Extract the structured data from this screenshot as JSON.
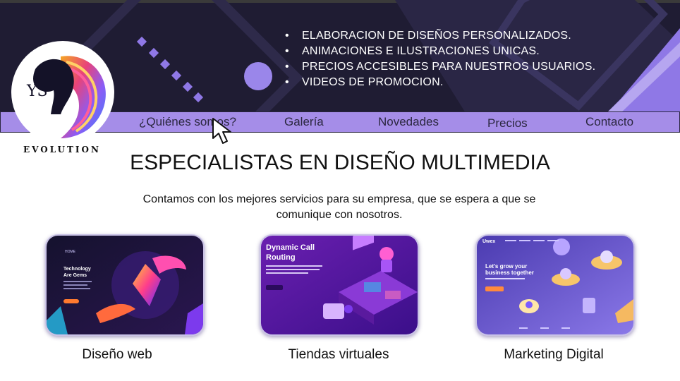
{
  "brand": {
    "name": "EVOLUTION",
    "monogram": "YS"
  },
  "hero": {
    "bullets": [
      "ELABORACION DE DISEÑOS PERSONALIZADOS.",
      "ANIMACIONES E ILUSTRACIONES UNICAS.",
      "PRECIOS ACCESIBLES PARA NUESTROS USUARIOS.",
      "VIDEOS DE PROMOCION."
    ]
  },
  "nav": {
    "items": [
      "¿Quiénes somos?",
      "Galería",
      "Novedades",
      "Precios",
      "Contacto"
    ]
  },
  "main": {
    "title": "ESPECIALISTAS EN DISEÑO MULTIMEDIA",
    "intro": "Contamos con los mejores servicios para su empresa, que se espera a que se comunique con nosotros."
  },
  "services": [
    {
      "label": "Diseño web",
      "image_text": {
        "nav": "HOME",
        "headline_1": "Technology",
        "headline_2": "Are Gems"
      }
    },
    {
      "label": "Tiendas virtuales",
      "image_text": {
        "headline_1": "Dynamic Call",
        "headline_2": "Routing"
      }
    },
    {
      "label": "Marketing Digital",
      "image_text": {
        "logo": "Uwex",
        "headline_1": "Let's grow your",
        "headline_2": "business together"
      }
    }
  ],
  "colors": {
    "hero_bg": "#1f1c33",
    "nav_bg": "#a58de8",
    "accent": "#8f78e6"
  },
  "icons": [
    "mouse-cursor-icon",
    "horse-logo-icon"
  ]
}
